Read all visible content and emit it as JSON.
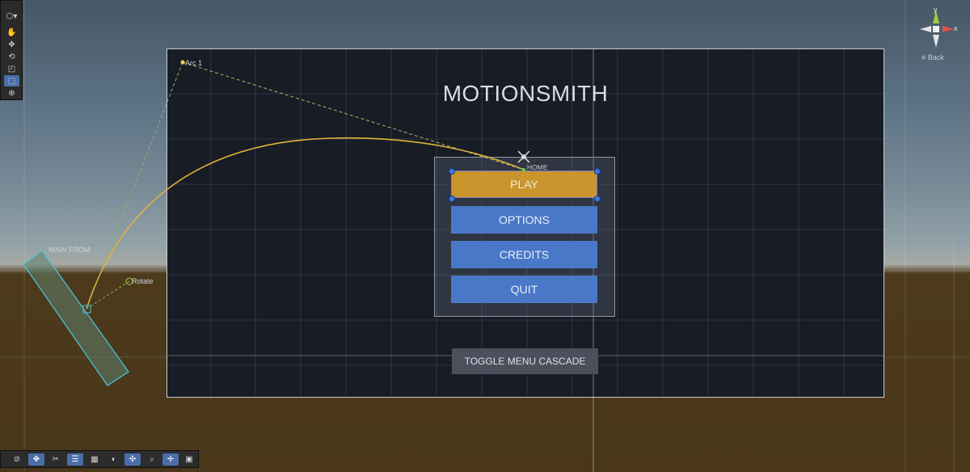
{
  "scene": {
    "title": "MOTIONSMITH",
    "menu": {
      "home_label": "HOME",
      "buttons": [
        {
          "label": "PLAY",
          "selected": true
        },
        {
          "label": "OPTIONS",
          "selected": false
        },
        {
          "label": "CREDITS",
          "selected": false
        },
        {
          "label": "QUIT",
          "selected": false
        }
      ]
    },
    "toggle_button": "TOGGLE MENU CASCADE",
    "labels": {
      "arc": "Arc 1",
      "main_from": "MAIN FROM",
      "rotate": "Rotate"
    }
  },
  "gizmo": {
    "y_axis": "y",
    "x_axis": "x",
    "back_label": "Back"
  },
  "tools": {
    "left_toolbar": [
      "view-dropdown-icon",
      "hand-tool-icon",
      "move-tool-icon",
      "rotate-tool-icon",
      "scale-tool-icon",
      "rect-tool-icon",
      "transform-tool-icon"
    ],
    "bottom_toolbar": [
      "compass-icon",
      "move-icon",
      "spline-icon",
      "tune-icon",
      "grid-icon",
      "arc-icon",
      "pivot-icon",
      "zoom-icon",
      "snap-icon",
      "display-icon"
    ]
  },
  "colors": {
    "button_blue": "#4a78c8",
    "button_selected": "#c9952c",
    "arc_path": "#e0b23a"
  }
}
